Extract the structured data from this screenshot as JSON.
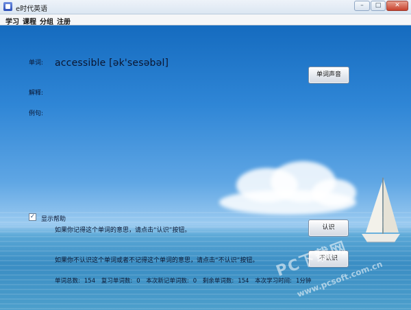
{
  "window": {
    "title": "e时代英语",
    "min": "–",
    "max": "□",
    "close": "✕"
  },
  "menu": [
    "学习",
    "课程",
    "分组",
    "注册"
  ],
  "labels": {
    "word": "单词:",
    "explanation": "解释:",
    "example": "例句:"
  },
  "word": "accessible [ək'sesəbəl]",
  "buttons": {
    "sound": "单词声音",
    "know": "认识",
    "dont_know": "不认识"
  },
  "help": {
    "checkbox_label": "显示帮助",
    "checked": true,
    "know_text": "如果你记得这个单词的意思，请点击“认识”按钮。",
    "dont_know_text": "如果你不认识这个单词或者不记得这个单词的意思，请点击“不认识”按钮。"
  },
  "stats": {
    "total_label": "单词总数:",
    "total": "154",
    "review_label": "复习单词数:",
    "review": "0",
    "new_label": "本次新记单词数:",
    "new": "0",
    "remain_label": "剩余单词数:",
    "remain": "154",
    "time_label": "本次学习时间:",
    "time": "1分钟"
  },
  "watermark": {
    "brand": "PC下载网",
    "url": "www.pcsoft.com.cn"
  },
  "icons": {
    "app": "app-icon",
    "checkbox": "check-icon"
  }
}
